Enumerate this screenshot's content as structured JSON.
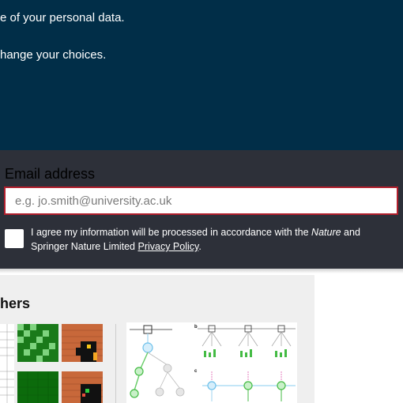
{
  "banner": {
    "line1": "e of your personal data.",
    "line2": "hange your choices."
  },
  "signup": {
    "email_label": "Email address",
    "email_placeholder": "e.g. jo.smith@university.ac.uk",
    "email_value": "",
    "consent_prefix": "I agree my information will be processed in accordance with the ",
    "consent_brand": "Nature",
    "consent_mid": " and Springer Nature Limited ",
    "consent_link": "Privacy Policy",
    "consent_suffix": ".",
    "consent_checked": false
  },
  "panel": {
    "heading": "hers"
  },
  "colors": {
    "banner_bg": "#012e48",
    "signup_bg": "#2d3039",
    "input_border": "#b21f2d",
    "panel_bg": "#efefef"
  },
  "figures": {
    "thumbnail_icons": [
      "grid-table-thumbnail",
      "green-grid-thumbnail",
      "brick-maze-thumbnail",
      "network-diagram-thumbnail"
    ]
  }
}
